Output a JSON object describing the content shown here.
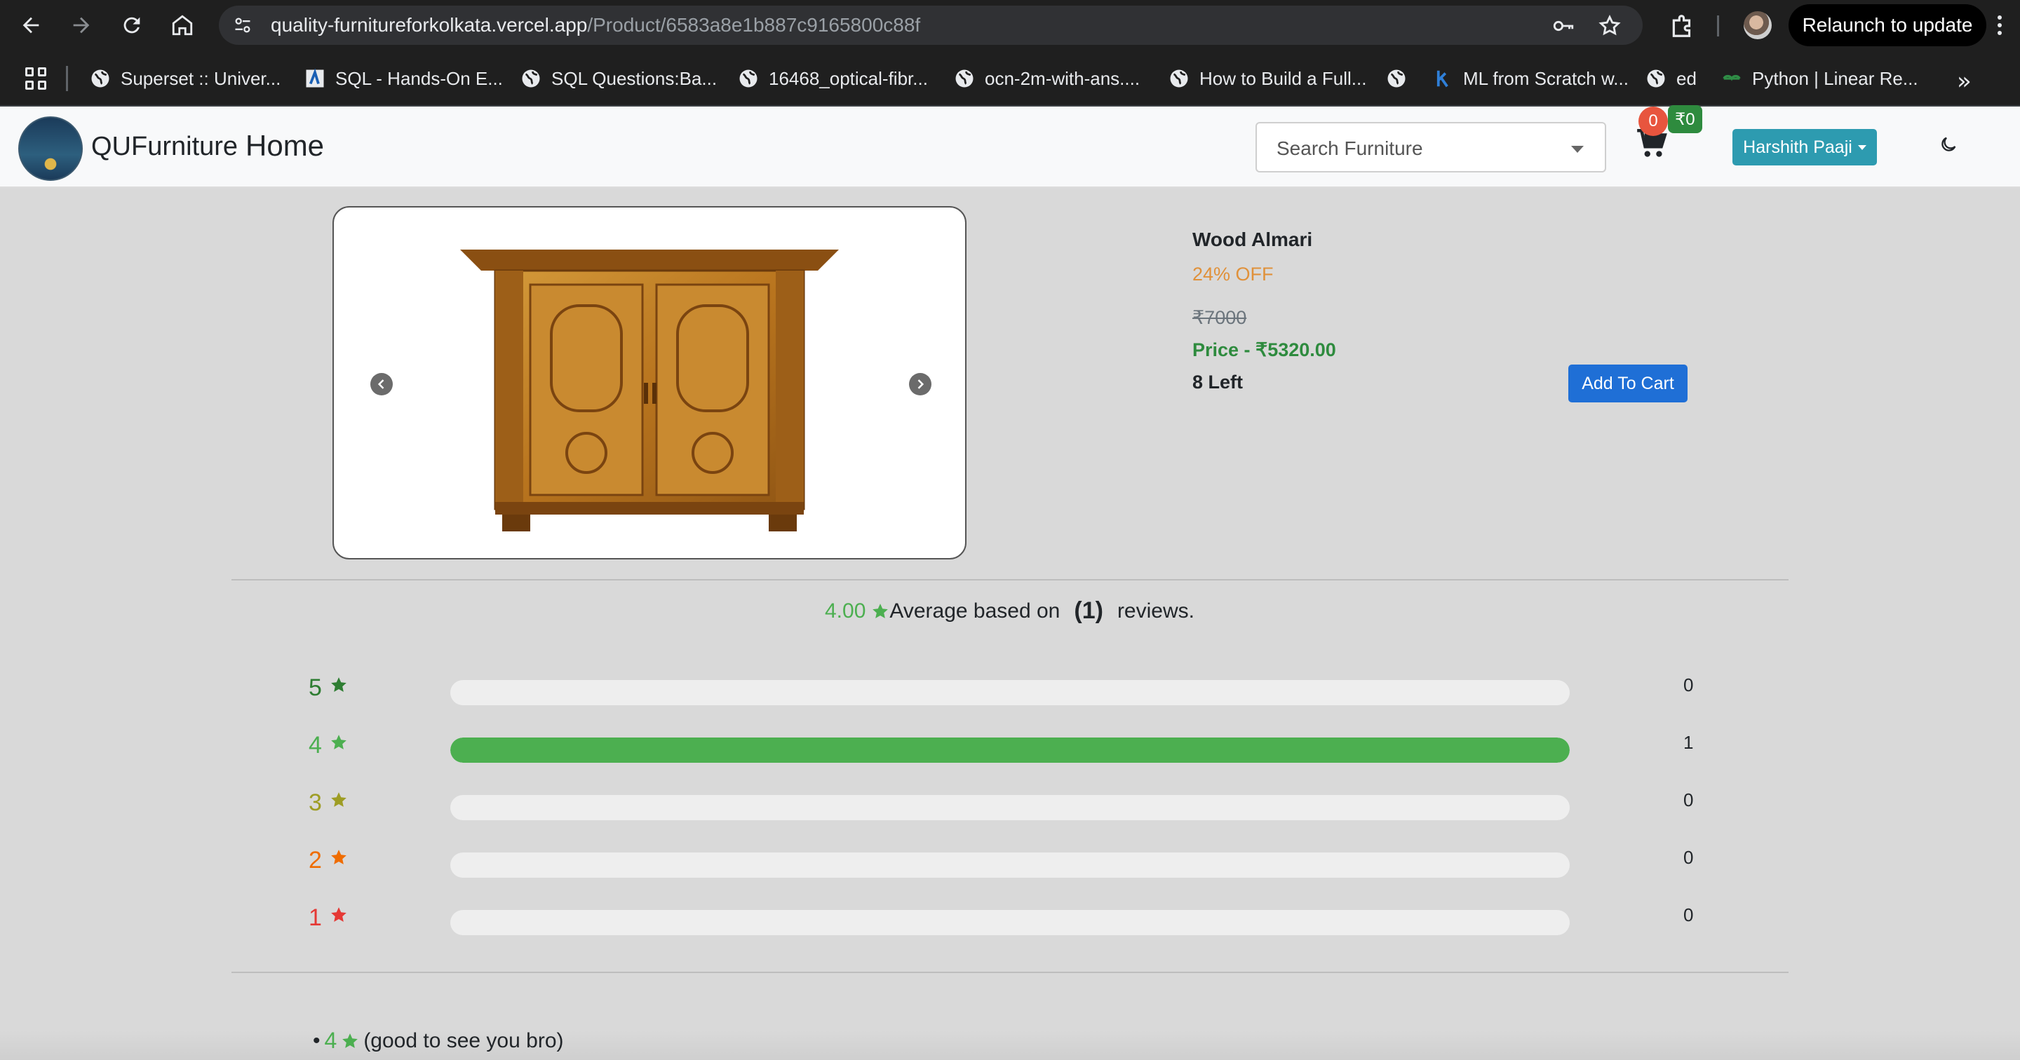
{
  "browser": {
    "url_host": "quality-furnitureforkolkata.vercel.app",
    "url_path": "/Product/6583a8e1b887c9165800c88f",
    "relaunch_label": "Relaunch to update",
    "bookmarks": [
      {
        "label": "Superset :: Univer..."
      },
      {
        "label": "SQL - Hands-On E..."
      },
      {
        "label": "SQL Questions:Ba..."
      },
      {
        "label": "16468_optical-fibr..."
      },
      {
        "label": "ocn-2m-with-ans...."
      },
      {
        "label": "How to Build a Full..."
      },
      {
        "label": ""
      },
      {
        "label": "ML from Scratch w..."
      },
      {
        "label": "ed"
      },
      {
        "label": "Python | Linear Re..."
      }
    ],
    "more_label": "»"
  },
  "navbar": {
    "brand": "QUFurniture",
    "home": "Home",
    "search_placeholder": "Search Furniture",
    "cart_count": "0",
    "cart_total": "₹0",
    "user_name": "Harshith Paaji"
  },
  "product": {
    "name": "Wood Almari",
    "discount": "24% OFF",
    "old_price": "₹7000",
    "price": "Price - ₹5320.00",
    "stock": "8 Left",
    "add_to_cart": "Add To Cart"
  },
  "reviews": {
    "average": "4.00",
    "avg_text": "Average based on",
    "count": "(1)",
    "suffix": "reviews.",
    "rows": [
      {
        "stars": "5",
        "count": "0",
        "fraction": 0,
        "color": "#2e7d32"
      },
      {
        "stars": "4",
        "count": "1",
        "fraction": 1,
        "color": "#4caf50"
      },
      {
        "stars": "3",
        "count": "0",
        "fraction": 0,
        "color": "#9e9d24"
      },
      {
        "stars": "2",
        "count": "0",
        "fraction": 0,
        "color": "#ef6c00"
      },
      {
        "stars": "1",
        "count": "0",
        "fraction": 0,
        "color": "#e53935"
      }
    ],
    "items": [
      {
        "bullet": "•",
        "rating": "4",
        "comment": "(good to see you bro)"
      }
    ]
  }
}
